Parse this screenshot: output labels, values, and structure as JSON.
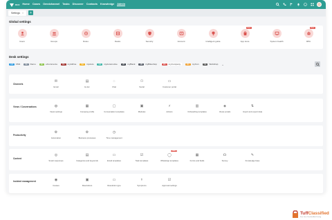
{
  "topbar": {
    "logo_text": "RUX",
    "nav": [
      "Home",
      "Cases",
      "Omnichannel",
      "Tasks",
      "Discover",
      "Contacts",
      "Knowledge",
      "Admin"
    ],
    "active_nav": "Admin"
  },
  "tabs": {
    "open": [
      {
        "label": "Settings",
        "close": "×"
      }
    ],
    "add_label": "+"
  },
  "global_settings": {
    "title": "Global settings",
    "items": [
      {
        "label": "Users",
        "icon": "users-icon"
      },
      {
        "label": "Groups",
        "icon": "groups-icon"
      },
      {
        "label": "Roles",
        "icon": "roles-icon"
      },
      {
        "label": "Desks",
        "icon": "desks-icon"
      },
      {
        "label": "Security",
        "icon": "security-icon"
      },
      {
        "label": "Account",
        "icon": "account-icon"
      },
      {
        "label": "Intelligent guide",
        "icon": "guide-icon"
      },
      {
        "label": "App store",
        "icon": "app-store-icon",
        "badge": "New"
      },
      {
        "label": "System health",
        "icon": "system-health-icon"
      },
      {
        "label": "RPA",
        "icon": "rpa-icon",
        "badge": "New"
      }
    ]
  },
  "desk_settings": {
    "title": "Desk settings",
    "desks": [
      {
        "badge": "CM",
        "label": "CM1",
        "color": "#2f9be0"
      },
      {
        "badge": "DE",
        "label": "Demo",
        "color": "#7d8a99"
      },
      {
        "badge": "EC",
        "label": "eCommerce",
        "color": "#8bc34a"
      },
      {
        "badge": "MA",
        "label": "myAirline",
        "color": "#a0312d"
      },
      {
        "badge": "MA",
        "label": "myAuto",
        "color": "#f2b01e"
      },
      {
        "badge": "MA",
        "label": "myAutomotive",
        "color": "#3fb6a8"
      },
      {
        "badge": "MB",
        "label": "myBank",
        "color": "#3a3f47"
      },
      {
        "badge": "MB",
        "label": "myBikeshop",
        "color": "#555b66"
      },
      {
        "badge": "MC",
        "label": "myCompany",
        "color": "#d9534f",
        "selected": true
      },
      {
        "badge": "MC",
        "label": "myCon",
        "color": "#f0a030"
      },
      {
        "badge": "WE",
        "label": "Webshop",
        "color": "#4a4a4a"
      }
    ],
    "more": "⌄"
  },
  "rows": [
    {
      "label": "Channels",
      "items": [
        {
          "label": "Email",
          "icon": "email-icon"
        },
        {
          "label": "E-doc",
          "icon": "edoc-icon"
        },
        {
          "label": "Chat",
          "icon": "chat-icon"
        },
        {
          "label": "Social",
          "icon": "social-icon"
        },
        {
          "label": "Customer portal",
          "icon": "customer-portal-icon"
        }
      ]
    },
    {
      "label": "Views / Conversations",
      "items": [
        {
          "label": "Views settings",
          "icon": "views-icon"
        },
        {
          "label": "Company profile",
          "icon": "company-profile-icon"
        },
        {
          "label": "Conversation templates",
          "icon": "conversation-templates-icon"
        },
        {
          "label": "Modules",
          "icon": "modules-icon"
        },
        {
          "label": "Actions",
          "icon": "actions-icon"
        },
        {
          "label": "Onboarding templates",
          "icon": "onboarding-icon"
        },
        {
          "label": "Views emails",
          "icon": "views-emails-icon"
        },
        {
          "label": "Import and export data",
          "icon": "import-export-icon"
        }
      ]
    },
    {
      "label": "Productivity",
      "items": [
        {
          "label": "Automation",
          "icon": "automation-icon"
        },
        {
          "label": "Business processes",
          "icon": "business-processes-icon"
        },
        {
          "label": "Time management",
          "icon": "time-management-icon"
        }
      ]
    },
    {
      "label": "Content",
      "items": [
        {
          "label": "Smart responses",
          "icon": "smart-responses-icon"
        },
        {
          "label": "Categories and keywords",
          "icon": "categories-icon"
        },
        {
          "label": "Email templates",
          "icon": "email-templates-icon"
        },
        {
          "label": "Task templates",
          "icon": "task-templates-icon"
        },
        {
          "label": "WhatsApp templates",
          "icon": "whatsapp-icon",
          "badge": "New"
        },
        {
          "label": "Forms and fields",
          "icon": "forms-icon"
        },
        {
          "label": "Survey",
          "icon": "survey-icon"
        },
        {
          "label": "Knowledge base",
          "icon": "knowledge-icon"
        }
      ]
    },
    {
      "label": "Incident management",
      "items": [
        {
          "label": "Causes",
          "icon": "causes-icon"
        },
        {
          "label": "Resolutions",
          "icon": "resolutions-icon"
        },
        {
          "label": "Resolution type",
          "icon": "resolution-type-icon"
        },
        {
          "label": "Symptoms",
          "icon": "symptoms-icon"
        },
        {
          "label": "Approval settings",
          "icon": "approval-icon"
        }
      ]
    }
  ],
  "watermark": {
    "brand_1": "Tuff",
    "brand_2": "Classified",
    "tagline": "Free Your Classified Ads Posting"
  }
}
